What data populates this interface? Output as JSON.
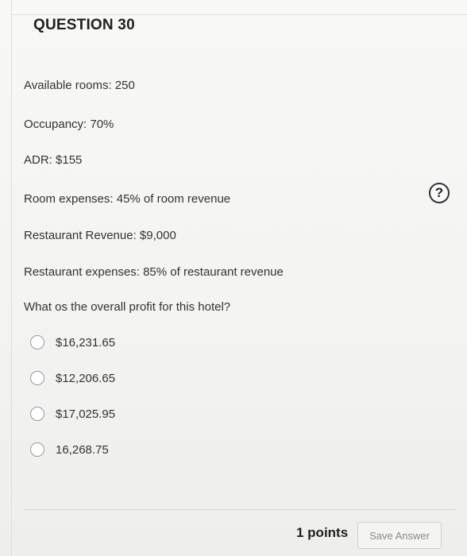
{
  "question": {
    "title": "QUESTION 30"
  },
  "given": [
    "Available rooms: 250",
    "Occupancy: 70%",
    "ADR: $155",
    "Room expenses: 45% of room revenue",
    "Restaurant Revenue: $9,000",
    "Restaurant expenses: 85% of restaurant revenue"
  ],
  "prompt": "What os the overall profit for this hotel?",
  "options": [
    "$16,231.65",
    "$12,206.65",
    "$17,025.95",
    "16,268.75"
  ],
  "help_icon": {
    "icon": "question-mark-circle-icon",
    "glyph": "?"
  },
  "footer": {
    "points": "1 points",
    "save_label": "Save Answer"
  }
}
